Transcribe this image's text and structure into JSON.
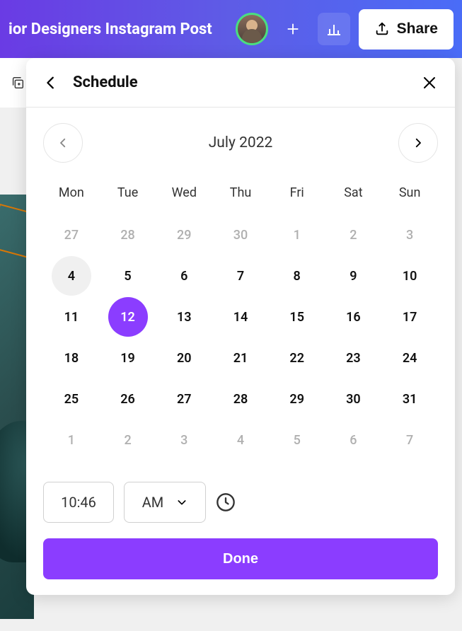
{
  "header": {
    "doc_title": "ior Designers Instagram Post",
    "share_label": "Share"
  },
  "modal": {
    "title": "Schedule",
    "month": "July 2022",
    "dow": [
      "Mon",
      "Tue",
      "Wed",
      "Thu",
      "Fri",
      "Sat",
      "Sun"
    ],
    "weeks": [
      [
        {
          "d": "27",
          "out": true
        },
        {
          "d": "28",
          "out": true
        },
        {
          "d": "29",
          "out": true
        },
        {
          "d": "30",
          "out": true
        },
        {
          "d": "1",
          "out": true
        },
        {
          "d": "2",
          "out": true
        },
        {
          "d": "3",
          "out": true
        }
      ],
      [
        {
          "d": "4",
          "today": true
        },
        {
          "d": "5"
        },
        {
          "d": "6"
        },
        {
          "d": "7"
        },
        {
          "d": "8"
        },
        {
          "d": "9"
        },
        {
          "d": "10"
        }
      ],
      [
        {
          "d": "11"
        },
        {
          "d": "12",
          "selected": true
        },
        {
          "d": "13"
        },
        {
          "d": "14"
        },
        {
          "d": "15"
        },
        {
          "d": "16"
        },
        {
          "d": "17"
        }
      ],
      [
        {
          "d": "18"
        },
        {
          "d": "19"
        },
        {
          "d": "20"
        },
        {
          "d": "21"
        },
        {
          "d": "22"
        },
        {
          "d": "23"
        },
        {
          "d": "24"
        }
      ],
      [
        {
          "d": "25"
        },
        {
          "d": "26"
        },
        {
          "d": "27"
        },
        {
          "d": "28"
        },
        {
          "d": "29"
        },
        {
          "d": "30"
        },
        {
          "d": "31"
        }
      ],
      [
        {
          "d": "1",
          "out": true
        },
        {
          "d": "2",
          "out": true
        },
        {
          "d": "3",
          "out": true
        },
        {
          "d": "4",
          "out": true
        },
        {
          "d": "5",
          "out": true
        },
        {
          "d": "6",
          "out": true
        },
        {
          "d": "7",
          "out": true
        }
      ]
    ],
    "time": "10:46",
    "ampm": "AM",
    "done_label": "Done"
  }
}
